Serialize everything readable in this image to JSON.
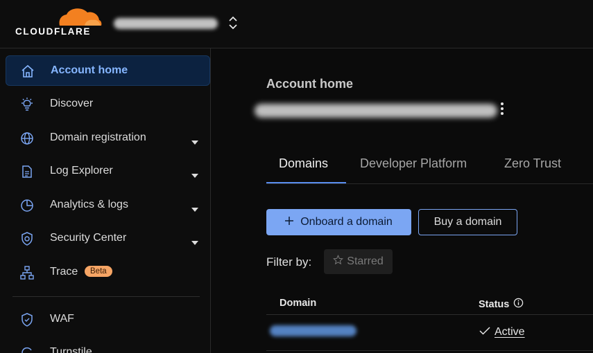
{
  "header": {
    "brand": "CLOUDFLARE",
    "brand_color": "#f38020"
  },
  "sidebar": {
    "items": [
      {
        "label": "Account home",
        "icon": "home-icon",
        "active": true
      },
      {
        "label": "Discover",
        "icon": "lightbulb-icon"
      },
      {
        "label": "Domain registration",
        "icon": "globe-icon",
        "expandable": true
      },
      {
        "label": "Log Explorer",
        "icon": "log-explorer-icon",
        "expandable": true
      },
      {
        "label": "Analytics & logs",
        "icon": "pie-chart-icon",
        "expandable": true
      },
      {
        "label": "Security Center",
        "icon": "security-center-icon",
        "expandable": true
      },
      {
        "label": "Trace",
        "icon": "trace-icon",
        "badge": "Beta"
      },
      {
        "label": "WAF",
        "icon": "shield-icon"
      },
      {
        "label": "Turnstile",
        "icon": "turnstile-icon"
      }
    ]
  },
  "main": {
    "title": "Account home",
    "tabs": [
      {
        "label": "Domains",
        "active": true
      },
      {
        "label": "Developer Platform"
      },
      {
        "label": "Zero Trust"
      }
    ],
    "actions": {
      "onboard_label": "Onboard a domain",
      "buy_label": "Buy a domain"
    },
    "filter": {
      "label": "Filter by:",
      "chip": "Starred"
    },
    "table": {
      "columns": [
        "Domain",
        "Status"
      ],
      "rows": [
        {
          "status": "Active"
        }
      ]
    }
  },
  "colors": {
    "accent": "#7ba6f3",
    "active_nav_bg": "#0c2240",
    "badge": "#f6a565"
  }
}
